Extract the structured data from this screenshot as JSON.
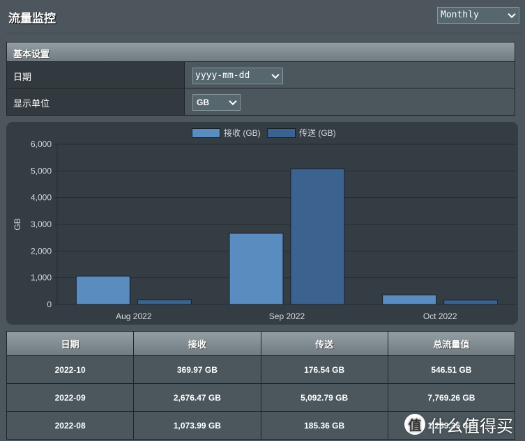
{
  "header": {
    "title": "流量监控",
    "period_select": {
      "value": "Monthly"
    }
  },
  "settings": {
    "section_title": "基本设置",
    "rows": [
      {
        "label": "日期",
        "control": "yyyy-mm-dd"
      },
      {
        "label": "显示单位",
        "control": "GB"
      }
    ]
  },
  "colors": {
    "received": "#5b8cc0",
    "sent": "#3c6390",
    "bar_border": "#16202a",
    "grid": "#272d31",
    "panel_bg": "#343d44",
    "page_bg": "#4d565d"
  },
  "chart_data": {
    "type": "bar",
    "title": "",
    "xlabel": "",
    "ylabel": "GB",
    "ylim": [
      0,
      6000
    ],
    "yticks": [
      0,
      1000,
      2000,
      3000,
      4000,
      5000,
      6000
    ],
    "ytick_labels": [
      "0",
      "1,000",
      "2,000",
      "3,000",
      "4,000",
      "5,000",
      "6,000"
    ],
    "categories": [
      "Aug 2022",
      "Sep 2022",
      "Oct 2022"
    ],
    "legend_position": "top-center",
    "grid": true,
    "series": [
      {
        "name": "接收 (GB)",
        "values": [
          1073.99,
          2676.47,
          369.97
        ]
      },
      {
        "name": "传送 (GB)",
        "values": [
          185.36,
          5092.79,
          176.54
        ]
      }
    ]
  },
  "table": {
    "headers": [
      "日期",
      "接收",
      "传送",
      "总流量值"
    ],
    "rows": [
      [
        "2022-10",
        "369.97 GB",
        "176.54 GB",
        "546.51 GB"
      ],
      [
        "2022-09",
        "2,676.47 GB",
        "5,092.79 GB",
        "7,769.26 GB"
      ],
      [
        "2022-08",
        "1,073.99 GB",
        "185.36 GB",
        "1,259.35 GB"
      ]
    ]
  },
  "watermark": {
    "logo": "值",
    "text": "什么值得买"
  }
}
